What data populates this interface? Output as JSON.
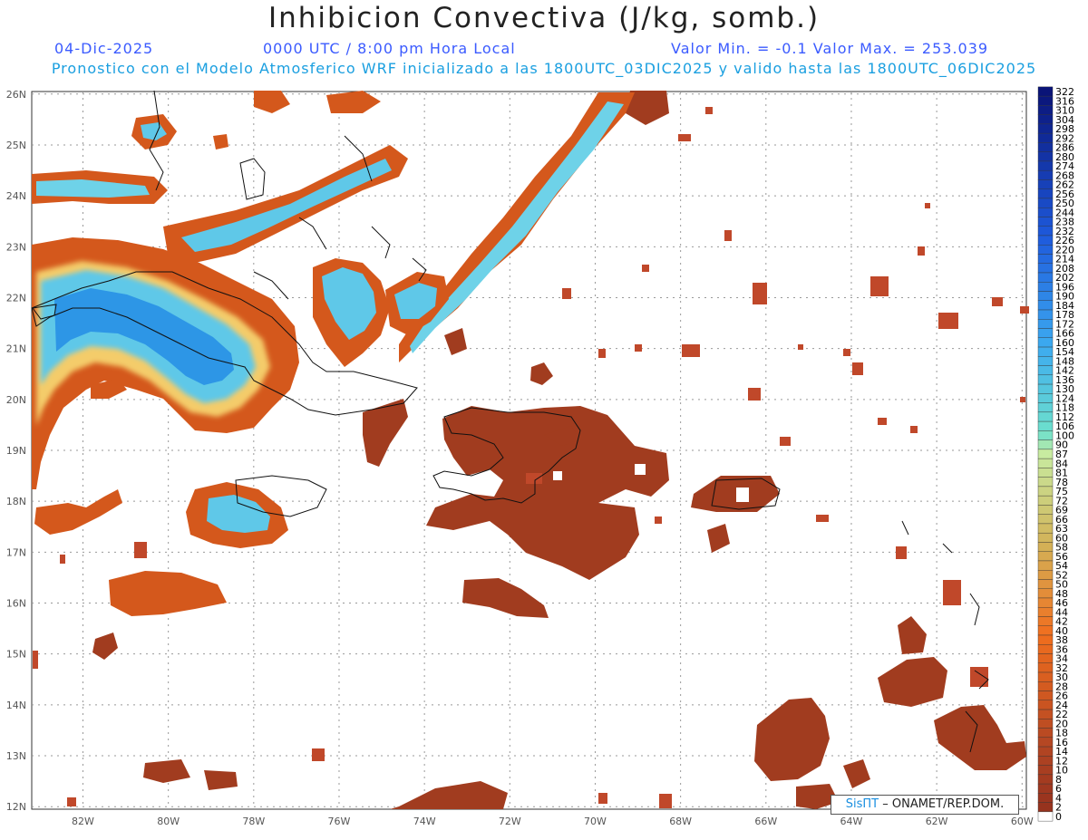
{
  "header": {
    "title": "Inhibicion Convectiva (J/kg, somb.)",
    "date": "04-Dic-2025",
    "time": "0000 UTC / 8:00 pm Hora Local",
    "minmax": "Valor Min. = -0.1  Valor Max. = 253.039",
    "forecast_info": "Pronostico con el Modelo Atmosferico WRF inicializado a las 1800UTC_03DIC2025 y valido hasta las  1800UTC_06DIC2025"
  },
  "map": {
    "lon_range": [
      -83.2,
      -59.9
    ],
    "lat_range": [
      11.95,
      26.05
    ],
    "lon_labels": [
      "82W",
      "80W",
      "78W",
      "76W",
      "74W",
      "72W",
      "70W",
      "68W",
      "66W",
      "64W",
      "62W",
      "60W"
    ],
    "lat_labels": [
      "12N",
      "13N",
      "14N",
      "15N",
      "16N",
      "17N",
      "18N",
      "19N",
      "20N",
      "21N",
      "22N",
      "23N",
      "24N",
      "25N",
      "26N"
    ]
  },
  "colorbar": {
    "labels": [
      "322",
      "316",
      "310",
      "304",
      "298",
      "292",
      "286",
      "280",
      "274",
      "268",
      "262",
      "256",
      "250",
      "244",
      "238",
      "232",
      "226",
      "220",
      "214",
      "208",
      "202",
      "196",
      "190",
      "184",
      "178",
      "172",
      "166",
      "160",
      "154",
      "148",
      "142",
      "136",
      "130",
      "124",
      "118",
      "112",
      "106",
      "100",
      "90",
      "87",
      "84",
      "81",
      "78",
      "75",
      "72",
      "69",
      "66",
      "63",
      "60",
      "58",
      "56",
      "54",
      "52",
      "50",
      "48",
      "46",
      "44",
      "42",
      "40",
      "38",
      "36",
      "34",
      "32",
      "30",
      "28",
      "26",
      "24",
      "22",
      "20",
      "18",
      "16",
      "14",
      "12",
      "10",
      "8",
      "6",
      "4",
      "2",
      "0"
    ]
  },
  "credit": {
    "brand": "SisПT",
    "org": "– ONAMET/REP.DOM."
  }
}
